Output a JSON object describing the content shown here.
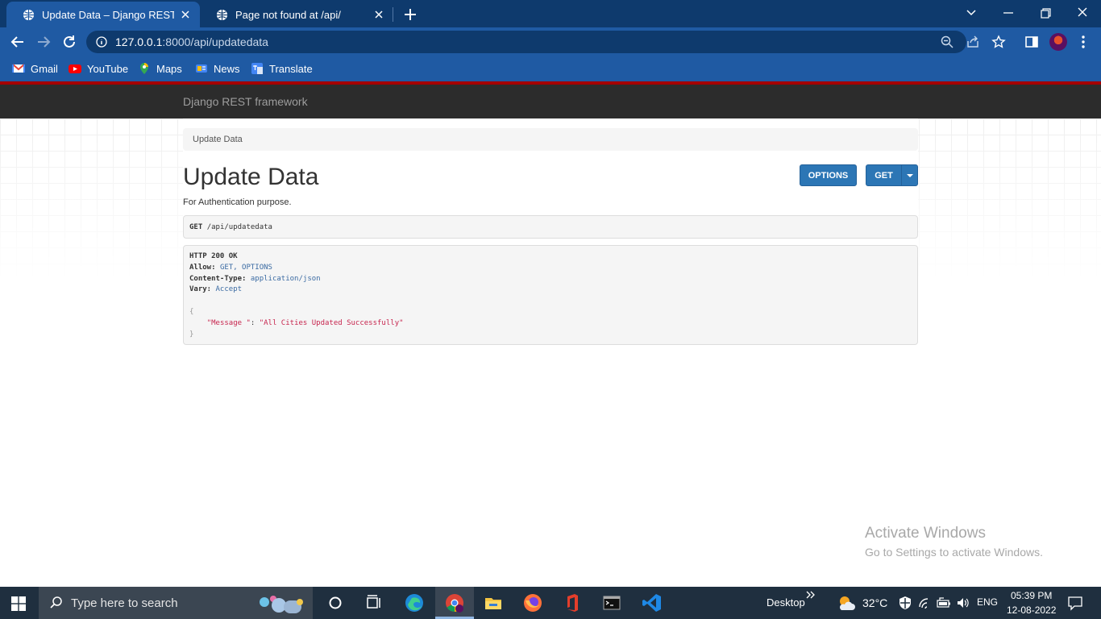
{
  "browser": {
    "tabs": [
      {
        "title": "Update Data – Django REST framework",
        "active": true
      },
      {
        "title": "Page not found at /api/",
        "active": false
      }
    ],
    "url": {
      "host": "127.0.0.1",
      "rest": ":8000/api/updatedata"
    },
    "bookmarks": [
      {
        "label": "Gmail",
        "icon": "gmail-icon"
      },
      {
        "label": "YouTube",
        "icon": "youtube-icon"
      },
      {
        "label": "Maps",
        "icon": "maps-icon"
      },
      {
        "label": "News",
        "icon": "news-icon"
      },
      {
        "label": "Translate",
        "icon": "translate-icon"
      }
    ]
  },
  "drf": {
    "brand": "Django REST framework",
    "breadcrumb": "Update Data",
    "title": "Update Data",
    "description": "For Authentication purpose.",
    "buttons": {
      "options": "OPTIONS",
      "get": "GET"
    },
    "request": {
      "method": "GET",
      "path": "/api/updatedata"
    },
    "response": {
      "status": "HTTP 200 OK",
      "headers": [
        {
          "key": "Allow:",
          "value": "GET, OPTIONS"
        },
        {
          "key": "Content-Type:",
          "value": "application/json"
        },
        {
          "key": "Vary:",
          "value": "Accept"
        }
      ],
      "body_open": "{",
      "body_key": "\"Message \"",
      "body_sep": ": ",
      "body_value": "\"All Cities Updated Successfully\"",
      "body_close": "}"
    }
  },
  "watermark": {
    "line1": "Activate Windows",
    "line2": "Go to Settings to activate Windows."
  },
  "taskbar": {
    "search_placeholder": "Type here to search",
    "desktop_label": "Desktop",
    "temperature": "32°C",
    "language": "ENG",
    "time": "05:39 PM",
    "date": "12-08-2022"
  },
  "colors": {
    "chrome_dark": "#0e3a6d",
    "chrome": "#1f5aa3",
    "drf_nav": "#2c2c2c",
    "drf_red": "#a30000",
    "btn_primary": "#2c76b5",
    "taskbar": "#1f2f3f"
  }
}
